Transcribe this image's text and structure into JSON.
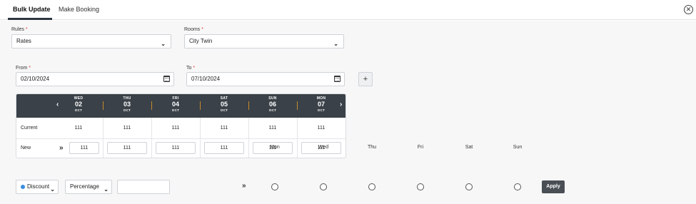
{
  "tabs": [
    {
      "label": "Bulk Update",
      "active": true
    },
    {
      "label": "Make Booking",
      "active": false
    }
  ],
  "close_icon": "close-circle-icon",
  "rules": {
    "label": "Rules",
    "required_mark": "*",
    "value": "Rates"
  },
  "rooms": {
    "label": "Rooms",
    "required_mark": "*",
    "value": "City Twin"
  },
  "from": {
    "label": "From",
    "required_mark": "*",
    "value": "02/10/2024"
  },
  "to": {
    "label": "To",
    "required_mark": "*",
    "value": "07/10/2024"
  },
  "add_label": "+",
  "grid": {
    "prev_icon": "‹",
    "next_icon": "›",
    "days": [
      {
        "dow": "WED",
        "date": "02",
        "month": "OCT",
        "current": "111",
        "new": "111"
      },
      {
        "dow": "THU",
        "date": "03",
        "month": "OCT",
        "current": "111",
        "new": "111"
      },
      {
        "dow": "FRI",
        "date": "04",
        "month": "OCT",
        "current": "111",
        "new": "111"
      },
      {
        "dow": "SAT",
        "date": "05",
        "month": "OCT",
        "current": "111",
        "new": "111"
      },
      {
        "dow": "SUN",
        "date": "06",
        "month": "OCT",
        "current": "111",
        "new": "111"
      },
      {
        "dow": "MON",
        "date": "07",
        "month": "OCT",
        "current": "111",
        "new": "111"
      }
    ],
    "row_current_label": "Current",
    "row_new_label": "New",
    "copy_icon": "»"
  },
  "bulk": {
    "type_value": "Discount",
    "mode_value": "Percentage",
    "amount_value": "",
    "apply_icon": "»",
    "weekdays": [
      "Mon",
      "Wed",
      "Thu",
      "Fri",
      "Sat",
      "Sun"
    ],
    "apply_label": "Apply"
  },
  "colors": {
    "accent": "#3a8de0",
    "header_dark": "#3a4148",
    "required": "#e23b3b"
  }
}
